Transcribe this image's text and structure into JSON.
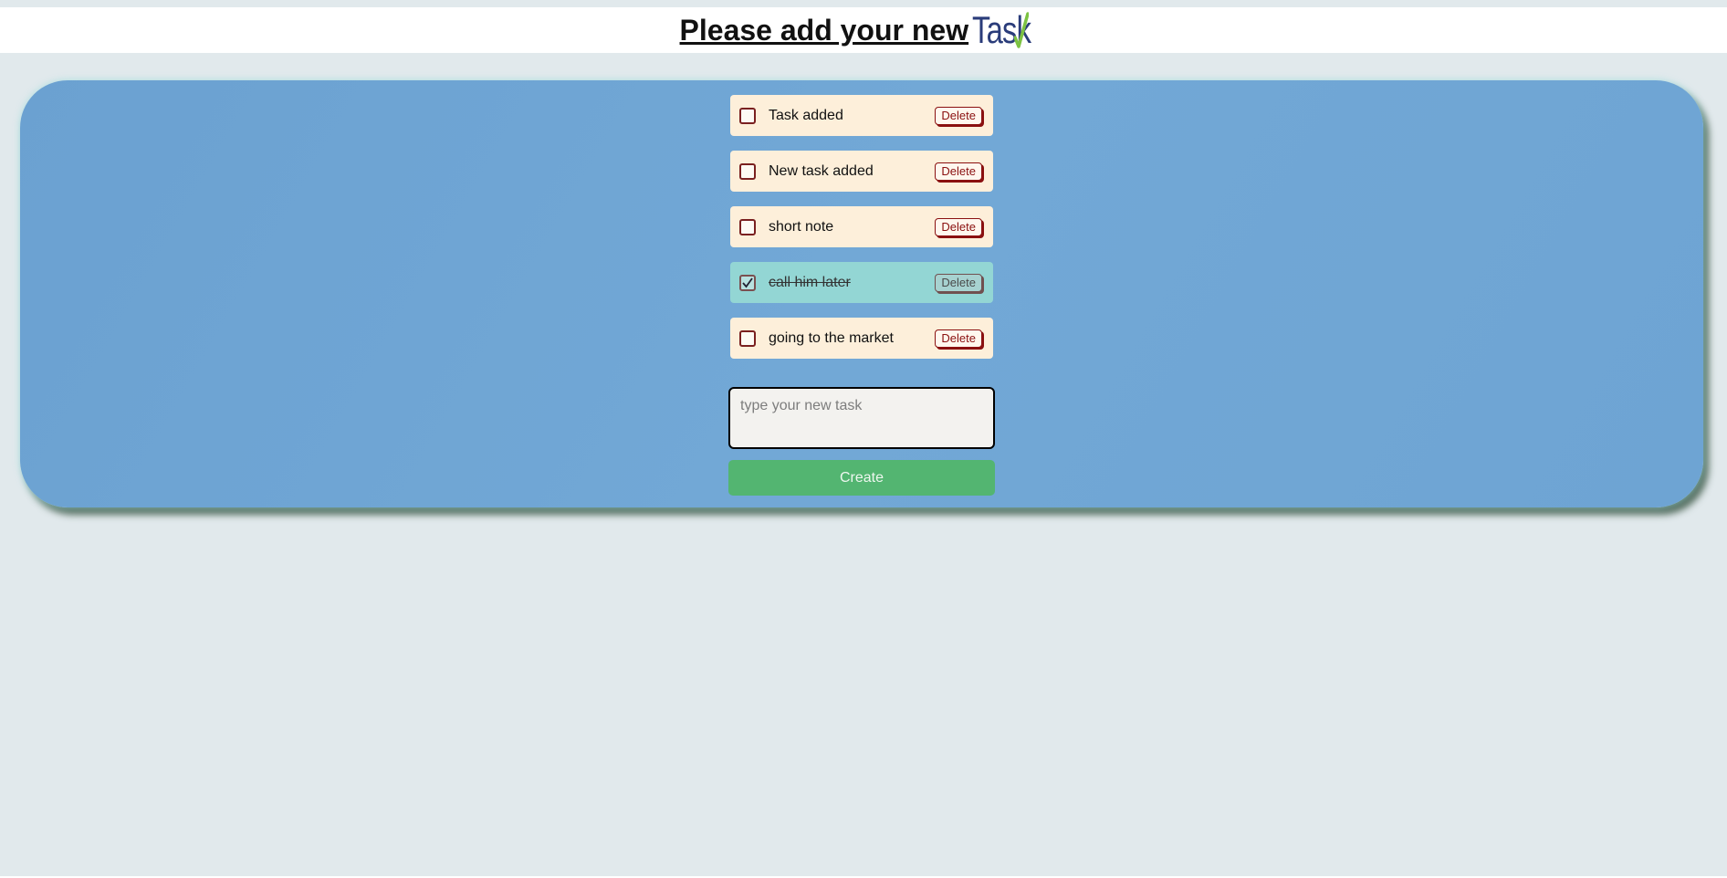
{
  "header": {
    "title": "Please add your new",
    "logo_text": "Task",
    "logo_colors": {
      "text": "#2a3c7a",
      "check": "#7cc242"
    }
  },
  "tasks": [
    {
      "label": "Task added",
      "checked": false,
      "delete_label": "Delete"
    },
    {
      "label": "New task added",
      "checked": false,
      "delete_label": "Delete"
    },
    {
      "label": "short note",
      "checked": false,
      "delete_label": "Delete"
    },
    {
      "label": "call him later",
      "checked": true,
      "delete_label": "Delete"
    },
    {
      "label": "going to the market",
      "checked": false,
      "delete_label": "Delete"
    }
  ],
  "form": {
    "input_value": "",
    "input_placeholder": "type your new task",
    "create_label": "Create"
  },
  "colors": {
    "background": "#e1e9ec",
    "panel": "#6ea4d3",
    "task": "#fdefda",
    "task_done": "#93d6d4",
    "delete": "#8a1010",
    "create": "#53b571"
  }
}
